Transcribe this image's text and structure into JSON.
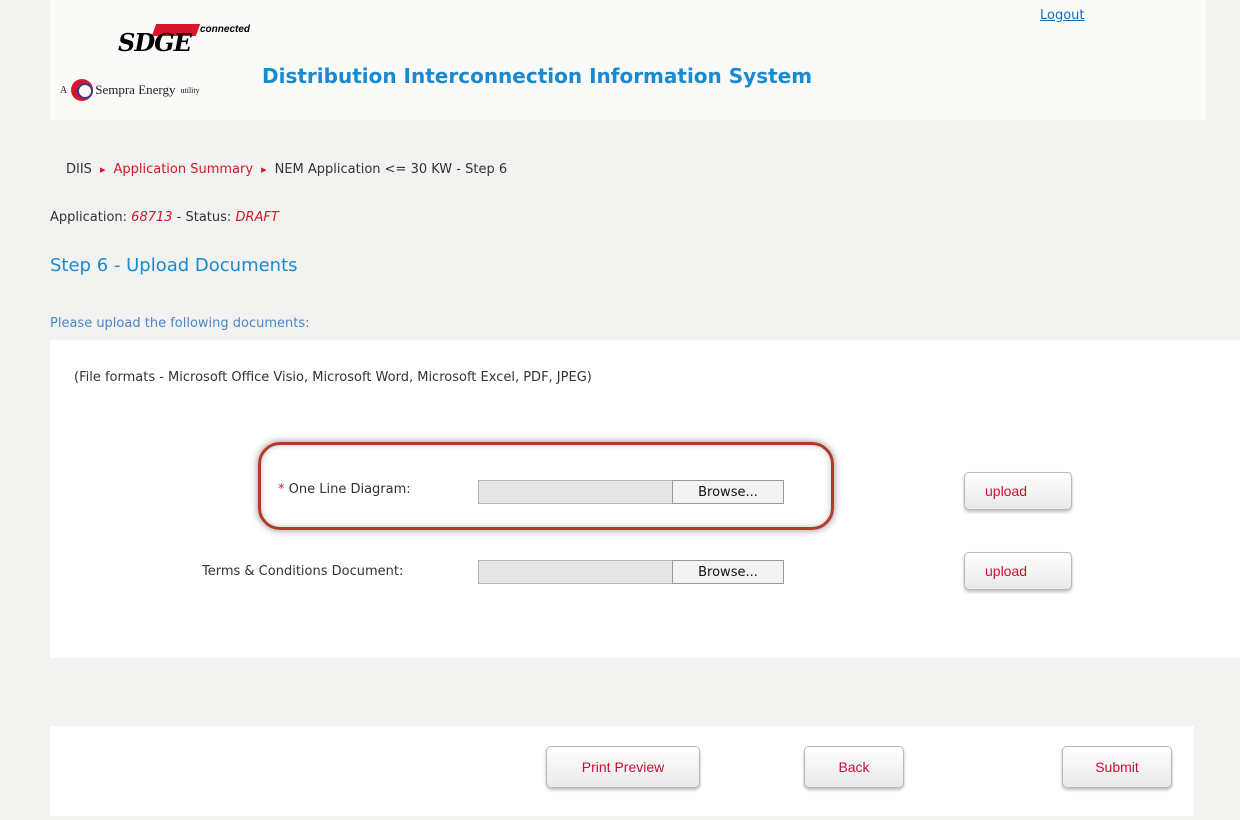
{
  "header": {
    "logout_label": "Logout",
    "logo_sdge": "SDGE",
    "logo_connected": "connected",
    "logo_sempra_prefix": "A",
    "logo_sempra": "Sempra Energy",
    "logo_utility": "utility",
    "app_title": "Distribution Interconnection Information System"
  },
  "breadcrumb": {
    "items": [
      "DIIS",
      "Application Summary",
      "NEM Application <= 30 KW - Step 6"
    ]
  },
  "application": {
    "label": "Application:",
    "number": "68713",
    "status_label": "- Status:",
    "status": "DRAFT"
  },
  "step": {
    "title": "Step 6 - Upload Documents",
    "instruction": "Please upload the following documents:",
    "formats": "(File formats - Microsoft Office Visio, Microsoft Word, Microsoft Excel, PDF, JPEG)"
  },
  "uploads": [
    {
      "required_mark": "*",
      "label": "One Line Diagram:",
      "browse_label": "Browse...",
      "upload_label": "upload",
      "value": ""
    },
    {
      "required_mark": "",
      "label": "Terms & Conditions Document:",
      "browse_label": "Browse...",
      "upload_label": "upload",
      "value": ""
    }
  ],
  "footer": {
    "print_preview_label": "Print Preview",
    "back_label": "Back",
    "submit_label": "Submit"
  },
  "colors": {
    "accent_blue": "#1a8ad0",
    "brand_red": "#d8152b",
    "highlight_ring": "#b23a2a"
  }
}
